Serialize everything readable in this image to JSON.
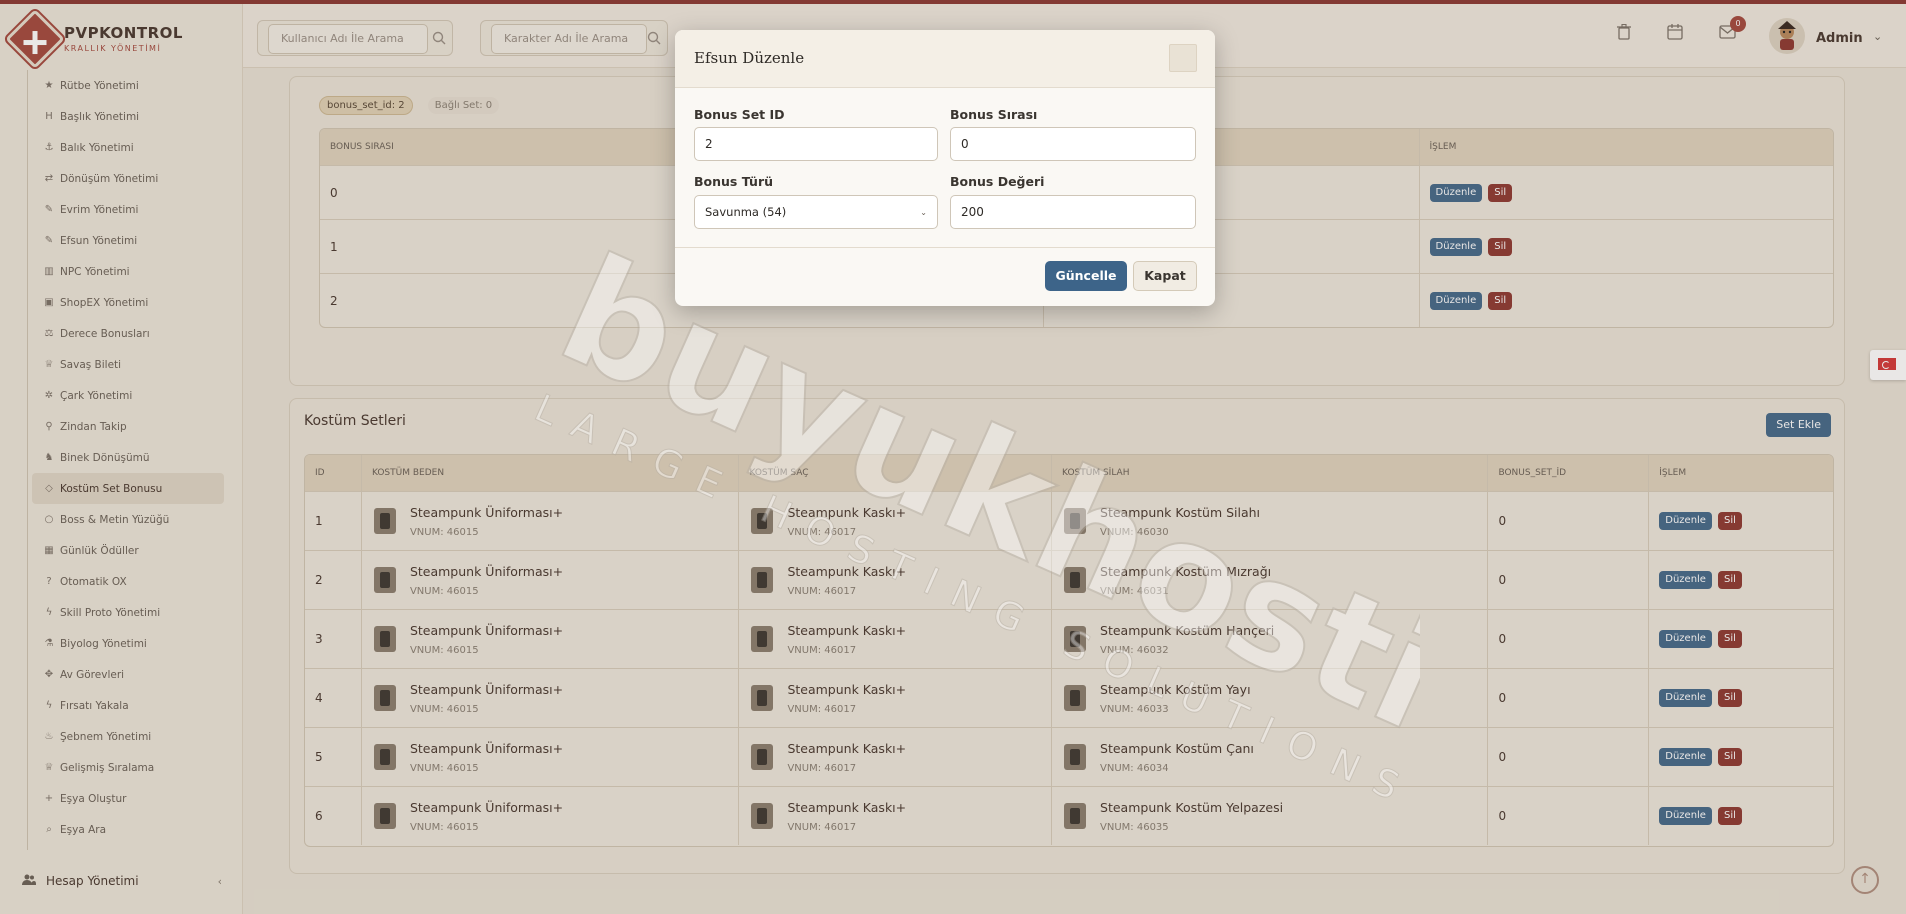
{
  "brand": {
    "title": "PVPKONTROL",
    "subtitle": "KRALLIK YÖNETİMİ"
  },
  "sidebar": {
    "items": [
      {
        "label": "Rütbe Yönetimi",
        "icon": "star-icon"
      },
      {
        "label": "Başlık Yönetimi",
        "icon": "heading-icon"
      },
      {
        "label": "Balık Yönetimi",
        "icon": "fish-icon"
      },
      {
        "label": "Dönüşüm Yönetimi",
        "icon": "shuffle-icon"
      },
      {
        "label": "Evrim Yönetimi",
        "icon": "wand-icon"
      },
      {
        "label": "Efsun Yönetimi",
        "icon": "wand-icon"
      },
      {
        "label": "NPC Yönetimi",
        "icon": "building-icon"
      },
      {
        "label": "ShopEX Yönetimi",
        "icon": "store-icon"
      },
      {
        "label": "Derece Bonusları",
        "icon": "scale-icon"
      },
      {
        "label": "Savaş Bileti",
        "icon": "trophy-icon"
      },
      {
        "label": "Çark Yönetimi",
        "icon": "wheel-icon"
      },
      {
        "label": "Zindan Takip",
        "icon": "pin-icon"
      },
      {
        "label": "Binek Dönüşümü",
        "icon": "horse-icon"
      },
      {
        "label": "Kostüm Set Bonusu",
        "icon": "gem-icon",
        "active": true
      },
      {
        "label": "Boss & Metin Yüzüğü",
        "icon": "ring-icon"
      },
      {
        "label": "Günlük Ödüller",
        "icon": "calendar-icon"
      },
      {
        "label": "Otomatik OX",
        "icon": "question-icon"
      },
      {
        "label": "Skill Proto Yönetimi",
        "icon": "bolt-icon"
      },
      {
        "label": "Biyolog Yönetimi",
        "icon": "flask-icon"
      },
      {
        "label": "Av Görevleri",
        "icon": "crosshair-icon"
      },
      {
        "label": "Fırsatı Yakala",
        "icon": "bolt-icon"
      },
      {
        "label": "Şebnem Yönetimi",
        "icon": "fire-icon"
      },
      {
        "label": "Gelişmiş Sıralama",
        "icon": "trophy-icon"
      },
      {
        "label": "Eşya Oluştur",
        "icon": "plus-icon"
      },
      {
        "label": "Eşya Ara",
        "icon": "search-icon"
      }
    ],
    "section": {
      "label": "Hesap Yönetimi",
      "icon": "users-icon"
    }
  },
  "header": {
    "search_user_placeholder": "Kullanıcı Adı İle Arama",
    "search_char_placeholder": "Karakter Adı İle Arama",
    "mail_count": "0",
    "user_name": "Admin"
  },
  "bonus_section": {
    "tag_set_id": "bonus_set_id: 2",
    "tag_linked": "Bağlı Set: 0",
    "headers": [
      "BONUS SIRASI",
      "İŞLEM"
    ],
    "rows": [
      {
        "order": "0",
        "edit": "Düzenle",
        "delete": "Sil"
      },
      {
        "order": "1",
        "edit": "Düzenle",
        "delete": "Sil"
      },
      {
        "order": "2",
        "edit": "Düzenle",
        "delete": "Sil"
      }
    ]
  },
  "costume_section": {
    "title": "Kostüm Setleri",
    "add_button": "Set Ekle",
    "headers": [
      "ID",
      "KOSTÜM BEDEN",
      "KOSTÜM SAÇ",
      "KOSTÜM SİLAH",
      "BONUS_SET_İD",
      "İŞLEM"
    ],
    "rows": [
      {
        "id": "1",
        "body": "Steampunk Üniforması+",
        "body_vnum": "VNUM: 46015",
        "hair": "Steampunk Kaskı+",
        "hair_vnum": "VNUM: 46017",
        "weapon": "Steampunk Kostüm Silahı",
        "weapon_vnum": "VNUM: 46030",
        "bonus_set": "0",
        "edit": "Düzenle",
        "delete": "Sil"
      },
      {
        "id": "2",
        "body": "Steampunk Üniforması+",
        "body_vnum": "VNUM: 46015",
        "hair": "Steampunk Kaskı+",
        "hair_vnum": "VNUM: 46017",
        "weapon": "Steampunk Kostüm Mızrağı",
        "weapon_vnum": "VNUM: 46031",
        "bonus_set": "0",
        "edit": "Düzenle",
        "delete": "Sil"
      },
      {
        "id": "3",
        "body": "Steampunk Üniforması+",
        "body_vnum": "VNUM: 46015",
        "hair": "Steampunk Kaskı+",
        "hair_vnum": "VNUM: 46017",
        "weapon": "Steampunk Kostüm Hançeri",
        "weapon_vnum": "VNUM: 46032",
        "bonus_set": "0",
        "edit": "Düzenle",
        "delete": "Sil"
      },
      {
        "id": "4",
        "body": "Steampunk Üniforması+",
        "body_vnum": "VNUM: 46015",
        "hair": "Steampunk Kaskı+",
        "hair_vnum": "VNUM: 46017",
        "weapon": "Steampunk Kostüm Yayı",
        "weapon_vnum": "VNUM: 46033",
        "bonus_set": "0",
        "edit": "Düzenle",
        "delete": "Sil"
      },
      {
        "id": "5",
        "body": "Steampunk Üniforması+",
        "body_vnum": "VNUM: 46015",
        "hair": "Steampunk Kaskı+",
        "hair_vnum": "VNUM: 46017",
        "weapon": "Steampunk Kostüm Çanı",
        "weapon_vnum": "VNUM: 46034",
        "bonus_set": "0",
        "edit": "Düzenle",
        "delete": "Sil"
      },
      {
        "id": "6",
        "body": "Steampunk Üniforması+",
        "body_vnum": "VNUM: 46015",
        "hair": "Steampunk Kaskı+",
        "hair_vnum": "VNUM: 46017",
        "weapon": "Steampunk Kostüm Yelpazesi",
        "weapon_vnum": "VNUM: 46035",
        "bonus_set": "0",
        "edit": "Düzenle",
        "delete": "Sil"
      }
    ]
  },
  "modal": {
    "title": "Efsun Düzenle",
    "fields": {
      "bonus_set_id": {
        "label": "Bonus Set ID",
        "value": "2"
      },
      "bonus_order": {
        "label": "Bonus Sırası",
        "value": "0"
      },
      "bonus_type": {
        "label": "Bonus Türü",
        "value": "Savunma (54)"
      },
      "bonus_value": {
        "label": "Bonus Değeri",
        "value": "200"
      }
    },
    "update_button": "Güncelle",
    "close_button": "Kapat"
  },
  "watermark": {
    "brand": "buyukhosting",
    "tagline": "LARGE HOSTING SOLUTIONS"
  },
  "colors": {
    "accent": "#a44a3f",
    "primary_button": "#3d6489",
    "danger": "#8f3b33",
    "background": "#e9e2d5"
  }
}
